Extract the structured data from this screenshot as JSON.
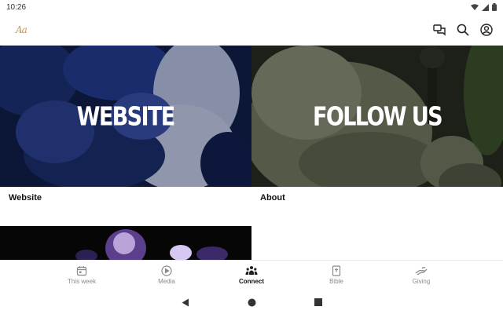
{
  "status_bar": {
    "time": "10:26"
  },
  "app_bar": {
    "logo_text": "Aa",
    "actions": [
      {
        "name": "messages-icon"
      },
      {
        "name": "search-icon"
      },
      {
        "name": "account-icon"
      }
    ]
  },
  "tiles": [
    {
      "title": "WEBSITE",
      "caption": "Website"
    },
    {
      "title": "FOLLOW US",
      "caption": "About"
    },
    {
      "title": "",
      "caption": ""
    }
  ],
  "bottom_nav": {
    "items": [
      {
        "label": "This week",
        "icon": "calendar-icon",
        "active": false
      },
      {
        "label": "Media",
        "icon": "play-circle-icon",
        "active": false
      },
      {
        "label": "Connect",
        "icon": "people-icon",
        "active": true
      },
      {
        "label": "Bible",
        "icon": "bible-icon",
        "active": false
      },
      {
        "label": "Giving",
        "icon": "giving-hand-icon",
        "active": false
      }
    ]
  },
  "colors": {
    "website_tint": "#1a2b66",
    "follow_tint": "#4a4e3d",
    "accent": "#c79a4a"
  }
}
